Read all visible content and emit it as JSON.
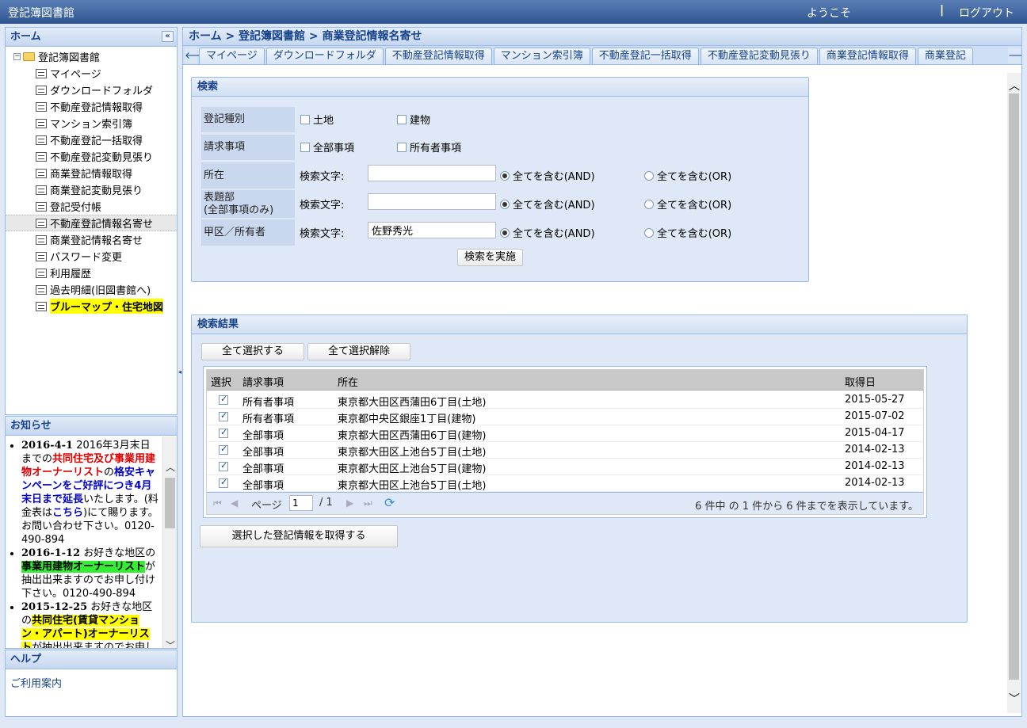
{
  "topbar": {
    "title": "登記簿図書館",
    "welcome": "ようこそ",
    "separator": "|",
    "logout": "ログアウト"
  },
  "sidebar": {
    "home_title": "ホーム",
    "collapse_label": "«",
    "tree": {
      "root_expander": "−",
      "root_label": "登記簿図書館",
      "items": [
        {
          "label": "マイページ"
        },
        {
          "label": "ダウンロードフォルダ"
        },
        {
          "label": "不動産登記情報取得"
        },
        {
          "label": "マンション索引簿"
        },
        {
          "label": "不動産登記一括取得"
        },
        {
          "label": "不動産登記変動見張り"
        },
        {
          "label": "商業登記情報取得"
        },
        {
          "label": "商業登記変動見張り"
        },
        {
          "label": "登記受付帳"
        },
        {
          "label": "不動産登記情報名寄せ"
        },
        {
          "label": "商業登記情報名寄せ"
        },
        {
          "label": "パスワード変更"
        },
        {
          "label": "利用履歴"
        },
        {
          "label": "過去明細(旧図書館へ)"
        },
        {
          "label": "ブルーマップ・住宅地図"
        }
      ]
    },
    "news_title": "お知らせ",
    "news": [
      {
        "date": "2016-4-1",
        "t1": " 2016年3月末日までの",
        "red1": "共同住宅及び事業用建物オーナーリスト",
        "t2": "の",
        "blue1": "格安キャンペーンをご好評につき4月末日まで延長",
        "t3": "いたします。(料金表は",
        "blue2": "こちら",
        "t4": ")にて賜ります。お問い合わせ下さい。0120-490-894"
      },
      {
        "date": "2016-1-12",
        "t1": " お好きな地区の",
        "green": "事業用建物オーナーリスト",
        "t2": "が抽出出来ますのでお申し付け下さい。0120-490-894"
      },
      {
        "date": "2015-12-25",
        "t1": " お好きな地区の",
        "yellow": "共同住宅(賃貸マンション・アパート)オーナーリスト",
        "t2": "が抽出出来ますのでお申し付け下さい。"
      }
    ],
    "help_title": "ヘルプ",
    "help_link": "ご利用案内"
  },
  "breadcrumb": "ホーム > 登記簿図書館 > 商業登記情報名寄せ",
  "tabs": [
    "マイページ",
    "ダウンロードフォルダ",
    "不動産登記情報取得",
    "マンション索引簿",
    "不動産登記一括取得",
    "不動産登記変動見張り",
    "商業登記情報取得",
    "商業登記"
  ],
  "search": {
    "title": "検索",
    "rows": {
      "type_label": "登記種別",
      "type_opt1": "土地",
      "type_opt2": "建物",
      "req_label": "請求事項",
      "req_opt1": "全部事項",
      "req_opt2": "所有者事項",
      "loc_label": "所在",
      "title_label": "表題部\n(全部事項のみ)",
      "owner_label": "甲区／所有者",
      "search_text": "検索文字:",
      "and_label": "全てを含む(AND)",
      "or_label": "全てを含む(OR)",
      "owner_value": "佐野秀光"
    },
    "submit": "検索を実施"
  },
  "results": {
    "title": "検索結果",
    "select_all": "全て選択する",
    "deselect_all": "全て選択解除",
    "columns": [
      "選択",
      "請求事項",
      "所在",
      "取得日"
    ],
    "rows": [
      {
        "type": "所有者事項",
        "location": "東京都大田区西蒲田6丁目(土地)",
        "date": "2015-05-27"
      },
      {
        "type": "所有者事項",
        "location": "東京都中央区銀座1丁目(建物)",
        "date": "2015-07-02"
      },
      {
        "type": "全部事項",
        "location": "東京都大田区西蒲田6丁目(建物)",
        "date": "2015-04-17"
      },
      {
        "type": "全部事項",
        "location": "東京都大田区上池台5丁目(土地)",
        "date": "2014-02-13"
      },
      {
        "type": "全部事項",
        "location": "東京都大田区上池台5丁目(建物)",
        "date": "2014-02-13"
      },
      {
        "type": "全部事項",
        "location": "東京都大田区上池台5丁目(土地)",
        "date": "2014-02-13"
      }
    ],
    "pager": {
      "page_label": "ページ",
      "page_value": "1",
      "page_total": "/ 1",
      "summary": "6 件中 の 1 件から 6 件までを表示しています。"
    },
    "fetch_selected": "選択した登記情報を取得する"
  }
}
